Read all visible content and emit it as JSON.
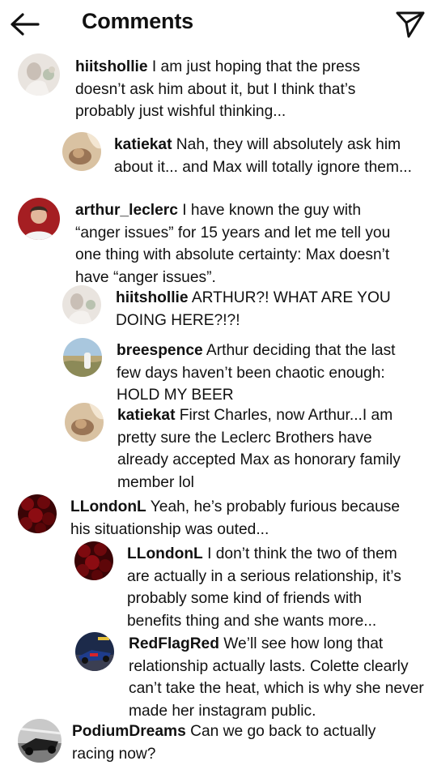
{
  "header": {
    "title": "Comments",
    "back_icon": "arrow-left-icon",
    "send_icon": "paper-plane-icon"
  },
  "comments": [
    {
      "username": "hiitshollie",
      "text": " I am just hoping that the press doesn’t ask him about it, but I think that’s probably just wishful thinking..."
    },
    {
      "username": "katiekat",
      "text": " Nah, they will absolutely ask him about it... and Max will totally ignore them..."
    },
    {
      "username": "arthur_leclerc",
      "text": "  I have known the guy with “anger issues” for 15 years and let me tell you one thing with absolute certainty: Max doesn’t have “anger issues”."
    },
    {
      "username": "hiitshollie",
      "text": " ARTHUR?! WHAT ARE YOU DOING HERE?!?!"
    },
    {
      "username": "breespence",
      "text": " Arthur deciding that the last few days haven’t been chaotic enough: HOLD MY BEER"
    },
    {
      "username": "katiekat",
      "text": " First Charles, now Arthur...I am pretty sure the Leclerc Brothers have already accepted Max as honorary family member lol"
    },
    {
      "username": "LLondonL",
      "text": " Yeah, he’s probably furious because his situationship was outed..."
    },
    {
      "username": "LLondonL",
      "text": "  I don’t think the two of them are actually in a serious relationship, it’s probably some kind of friends with benefits thing and she wants more..."
    },
    {
      "username": "RedFlagRed",
      "text": " We’ll see how long that relationship actually lasts. Colette clearly can’t take the heat, which is why she never made her instagram public."
    },
    {
      "username": "PodiumDreams",
      "text": " Can we go back to actually racing now?"
    }
  ]
}
